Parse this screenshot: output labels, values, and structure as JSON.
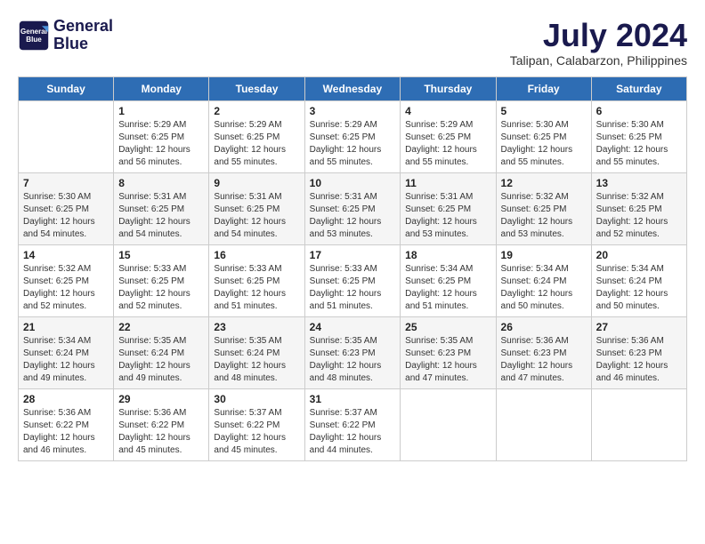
{
  "header": {
    "logo_line1": "General",
    "logo_line2": "Blue",
    "month_year": "July 2024",
    "location": "Talipan, Calabarzon, Philippines"
  },
  "days_of_week": [
    "Sunday",
    "Monday",
    "Tuesday",
    "Wednesday",
    "Thursday",
    "Friday",
    "Saturday"
  ],
  "weeks": [
    [
      {
        "day": "",
        "info": ""
      },
      {
        "day": "1",
        "info": "Sunrise: 5:29 AM\nSunset: 6:25 PM\nDaylight: 12 hours\nand 56 minutes."
      },
      {
        "day": "2",
        "info": "Sunrise: 5:29 AM\nSunset: 6:25 PM\nDaylight: 12 hours\nand 55 minutes."
      },
      {
        "day": "3",
        "info": "Sunrise: 5:29 AM\nSunset: 6:25 PM\nDaylight: 12 hours\nand 55 minutes."
      },
      {
        "day": "4",
        "info": "Sunrise: 5:29 AM\nSunset: 6:25 PM\nDaylight: 12 hours\nand 55 minutes."
      },
      {
        "day": "5",
        "info": "Sunrise: 5:30 AM\nSunset: 6:25 PM\nDaylight: 12 hours\nand 55 minutes."
      },
      {
        "day": "6",
        "info": "Sunrise: 5:30 AM\nSunset: 6:25 PM\nDaylight: 12 hours\nand 55 minutes."
      }
    ],
    [
      {
        "day": "7",
        "info": "Sunrise: 5:30 AM\nSunset: 6:25 PM\nDaylight: 12 hours\nand 54 minutes."
      },
      {
        "day": "8",
        "info": "Sunrise: 5:31 AM\nSunset: 6:25 PM\nDaylight: 12 hours\nand 54 minutes."
      },
      {
        "day": "9",
        "info": "Sunrise: 5:31 AM\nSunset: 6:25 PM\nDaylight: 12 hours\nand 54 minutes."
      },
      {
        "day": "10",
        "info": "Sunrise: 5:31 AM\nSunset: 6:25 PM\nDaylight: 12 hours\nand 53 minutes."
      },
      {
        "day": "11",
        "info": "Sunrise: 5:31 AM\nSunset: 6:25 PM\nDaylight: 12 hours\nand 53 minutes."
      },
      {
        "day": "12",
        "info": "Sunrise: 5:32 AM\nSunset: 6:25 PM\nDaylight: 12 hours\nand 53 minutes."
      },
      {
        "day": "13",
        "info": "Sunrise: 5:32 AM\nSunset: 6:25 PM\nDaylight: 12 hours\nand 52 minutes."
      }
    ],
    [
      {
        "day": "14",
        "info": "Sunrise: 5:32 AM\nSunset: 6:25 PM\nDaylight: 12 hours\nand 52 minutes."
      },
      {
        "day": "15",
        "info": "Sunrise: 5:33 AM\nSunset: 6:25 PM\nDaylight: 12 hours\nand 52 minutes."
      },
      {
        "day": "16",
        "info": "Sunrise: 5:33 AM\nSunset: 6:25 PM\nDaylight: 12 hours\nand 51 minutes."
      },
      {
        "day": "17",
        "info": "Sunrise: 5:33 AM\nSunset: 6:25 PM\nDaylight: 12 hours\nand 51 minutes."
      },
      {
        "day": "18",
        "info": "Sunrise: 5:34 AM\nSunset: 6:25 PM\nDaylight: 12 hours\nand 51 minutes."
      },
      {
        "day": "19",
        "info": "Sunrise: 5:34 AM\nSunset: 6:24 PM\nDaylight: 12 hours\nand 50 minutes."
      },
      {
        "day": "20",
        "info": "Sunrise: 5:34 AM\nSunset: 6:24 PM\nDaylight: 12 hours\nand 50 minutes."
      }
    ],
    [
      {
        "day": "21",
        "info": "Sunrise: 5:34 AM\nSunset: 6:24 PM\nDaylight: 12 hours\nand 49 minutes."
      },
      {
        "day": "22",
        "info": "Sunrise: 5:35 AM\nSunset: 6:24 PM\nDaylight: 12 hours\nand 49 minutes."
      },
      {
        "day": "23",
        "info": "Sunrise: 5:35 AM\nSunset: 6:24 PM\nDaylight: 12 hours\nand 48 minutes."
      },
      {
        "day": "24",
        "info": "Sunrise: 5:35 AM\nSunset: 6:23 PM\nDaylight: 12 hours\nand 48 minutes."
      },
      {
        "day": "25",
        "info": "Sunrise: 5:35 AM\nSunset: 6:23 PM\nDaylight: 12 hours\nand 47 minutes."
      },
      {
        "day": "26",
        "info": "Sunrise: 5:36 AM\nSunset: 6:23 PM\nDaylight: 12 hours\nand 47 minutes."
      },
      {
        "day": "27",
        "info": "Sunrise: 5:36 AM\nSunset: 6:23 PM\nDaylight: 12 hours\nand 46 minutes."
      }
    ],
    [
      {
        "day": "28",
        "info": "Sunrise: 5:36 AM\nSunset: 6:22 PM\nDaylight: 12 hours\nand 46 minutes."
      },
      {
        "day": "29",
        "info": "Sunrise: 5:36 AM\nSunset: 6:22 PM\nDaylight: 12 hours\nand 45 minutes."
      },
      {
        "day": "30",
        "info": "Sunrise: 5:37 AM\nSunset: 6:22 PM\nDaylight: 12 hours\nand 45 minutes."
      },
      {
        "day": "31",
        "info": "Sunrise: 5:37 AM\nSunset: 6:22 PM\nDaylight: 12 hours\nand 44 minutes."
      },
      {
        "day": "",
        "info": ""
      },
      {
        "day": "",
        "info": ""
      },
      {
        "day": "",
        "info": ""
      }
    ]
  ]
}
